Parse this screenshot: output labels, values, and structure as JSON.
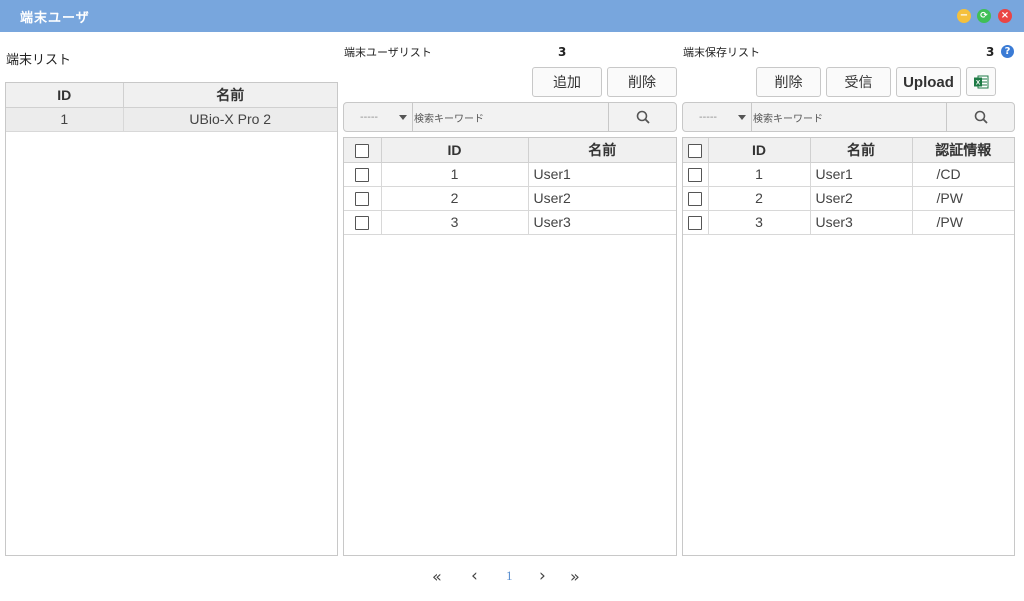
{
  "window": {
    "title": "端末ユーザ",
    "buttons": [
      "minimize",
      "restore",
      "close"
    ]
  },
  "device_list": {
    "label": "端末リスト",
    "columns": [
      "ID",
      "名前"
    ],
    "rows": [
      {
        "id": "1",
        "name": "UBio-X Pro 2",
        "selected": true
      }
    ]
  },
  "device_users": {
    "label": "端末ユーザリスト",
    "count": "3",
    "add_label": "追加",
    "delete_label": "削除",
    "filter_select": "-----",
    "search_placeholder": "検索キーワード",
    "columns": [
      "",
      "ID",
      "名前"
    ],
    "rows": [
      {
        "id": "1",
        "name": "User1"
      },
      {
        "id": "2",
        "name": "User2"
      },
      {
        "id": "3",
        "name": "User3"
      }
    ]
  },
  "stored_users": {
    "label": "端末保存リスト",
    "count": "3",
    "help_icon": "?",
    "delete_label": "削除",
    "receive_label": "受信",
    "upload_label": "Upload",
    "excel_icon": "excel-icon",
    "filter_select": "-----",
    "search_placeholder": "検索キーワード",
    "columns": [
      "",
      "ID",
      "名前",
      "認証情報"
    ],
    "rows": [
      {
        "id": "1",
        "name": "User1",
        "auth": "/CD"
      },
      {
        "id": "2",
        "name": "User2",
        "auth": "/PW"
      },
      {
        "id": "3",
        "name": "User3",
        "auth": "/PW"
      }
    ]
  },
  "pagination": {
    "first": "«",
    "prev": "‹",
    "current": "1",
    "next": "›",
    "last": "»"
  },
  "colors": {
    "titlebar": "#78a6dd",
    "accent": "#5a8fd0",
    "excel_green": "#1d7a45"
  }
}
